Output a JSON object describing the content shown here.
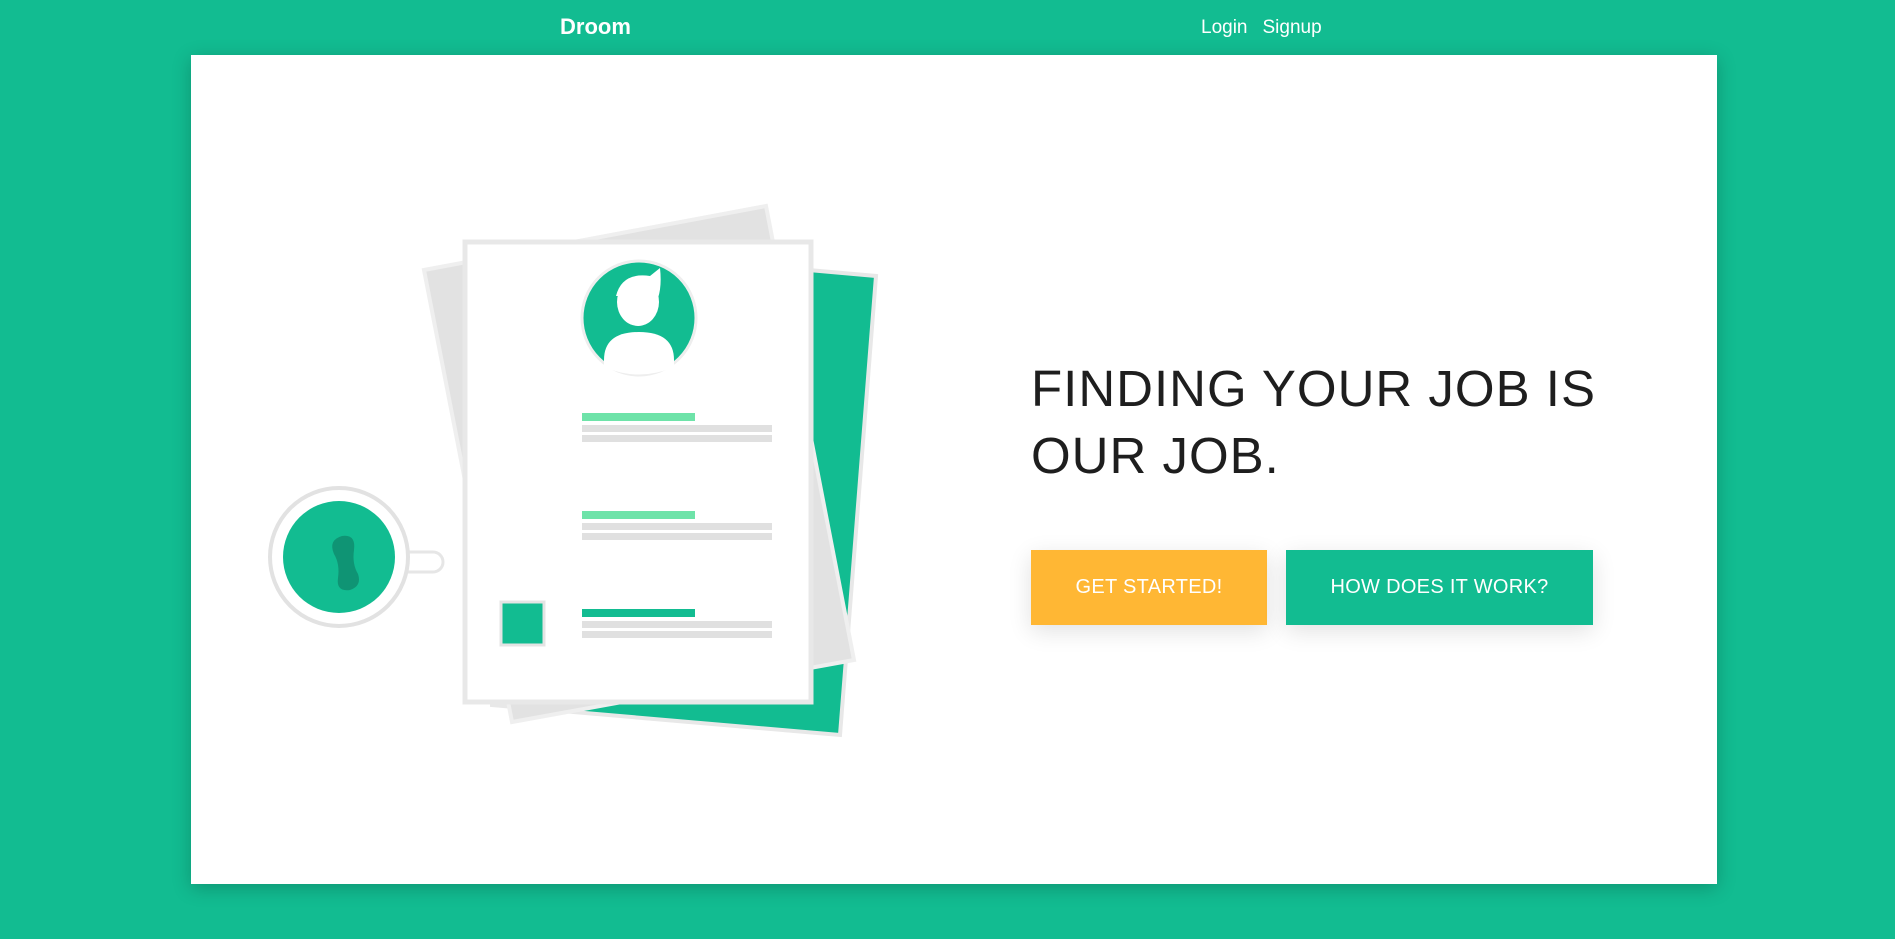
{
  "nav": {
    "brand": "Droom",
    "links": [
      "Login",
      "Signup"
    ]
  },
  "hero": {
    "headline_line1": "FINDING YOUR JOB IS",
    "headline_line2": "OUR JOB.",
    "primary_button": "GET STARTED!",
    "secondary_button": "HOW DOES IT WORK?"
  },
  "illustration": {
    "icons": [
      "resume-document-icon",
      "avatar-icon",
      "coffee-cup-icon"
    ]
  },
  "colors": {
    "background": "#12bc91",
    "accent_green": "#12bc91",
    "accent_yellow": "#ffb734",
    "light_green": "#6ee3a9",
    "text_dark": "#1e1e1e"
  }
}
